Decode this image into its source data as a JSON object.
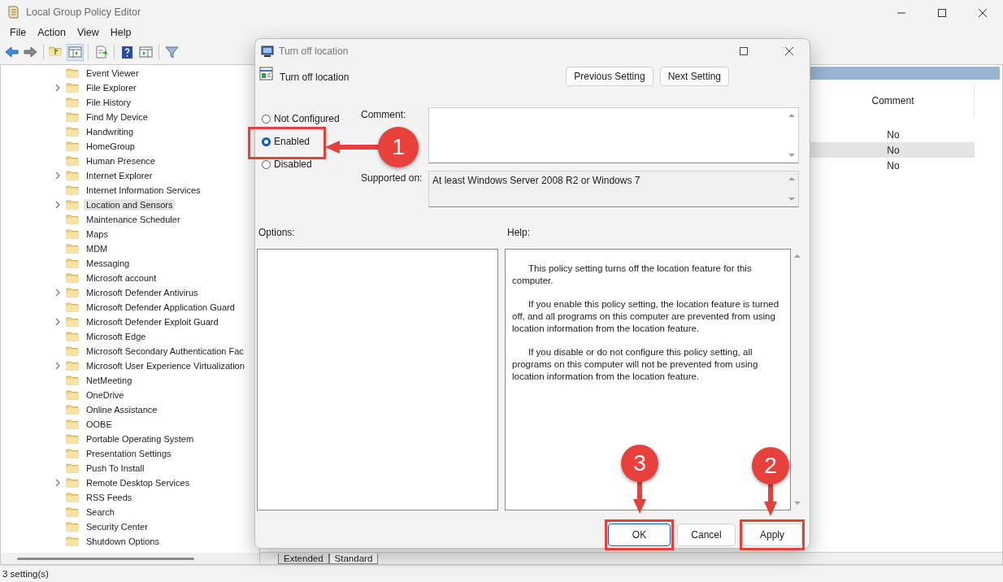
{
  "window": {
    "title": "Local Group Policy Editor"
  },
  "menu": [
    "File",
    "Action",
    "View",
    "Help"
  ],
  "tree": {
    "items": [
      {
        "label": "Event Viewer",
        "kind": "leaf",
        "selected": false
      },
      {
        "label": "File Explorer",
        "kind": "branch",
        "selected": false
      },
      {
        "label": "File History",
        "kind": "leaf",
        "selected": false
      },
      {
        "label": "Find My Device",
        "kind": "leaf",
        "selected": false
      },
      {
        "label": "Handwriting",
        "kind": "leaf",
        "selected": false
      },
      {
        "label": "HomeGroup",
        "kind": "leaf",
        "selected": false
      },
      {
        "label": "Human Presence",
        "kind": "leaf",
        "selected": false
      },
      {
        "label": "Internet Explorer",
        "kind": "branch",
        "selected": false
      },
      {
        "label": "Internet Information Services",
        "kind": "leaf",
        "selected": false
      },
      {
        "label": "Location and Sensors",
        "kind": "branch",
        "selected": true
      },
      {
        "label": "Maintenance Scheduler",
        "kind": "leaf",
        "selected": false
      },
      {
        "label": "Maps",
        "kind": "leaf",
        "selected": false
      },
      {
        "label": "MDM",
        "kind": "leaf",
        "selected": false
      },
      {
        "label": "Messaging",
        "kind": "leaf",
        "selected": false
      },
      {
        "label": "Microsoft account",
        "kind": "leaf",
        "selected": false
      },
      {
        "label": "Microsoft Defender Antivirus",
        "kind": "branch",
        "selected": false
      },
      {
        "label": "Microsoft Defender Application Guard",
        "kind": "leaf",
        "selected": false
      },
      {
        "label": "Microsoft Defender Exploit Guard",
        "kind": "branch",
        "selected": false
      },
      {
        "label": "Microsoft Edge",
        "kind": "leaf",
        "selected": false
      },
      {
        "label": "Microsoft Secondary Authentication Fac",
        "kind": "leaf",
        "selected": false
      },
      {
        "label": "Microsoft User Experience Virtualization",
        "kind": "branch",
        "selected": false
      },
      {
        "label": "NetMeeting",
        "kind": "leaf",
        "selected": false
      },
      {
        "label": "OneDrive",
        "kind": "leaf",
        "selected": false
      },
      {
        "label": "Online Assistance",
        "kind": "leaf",
        "selected": false
      },
      {
        "label": "OOBE",
        "kind": "leaf",
        "selected": false
      },
      {
        "label": "Portable Operating System",
        "kind": "leaf",
        "selected": false
      },
      {
        "label": "Presentation Settings",
        "kind": "leaf",
        "selected": false
      },
      {
        "label": "Push To Install",
        "kind": "leaf",
        "selected": false
      },
      {
        "label": "Remote Desktop Services",
        "kind": "branch",
        "selected": false
      },
      {
        "label": "RSS Feeds",
        "kind": "leaf",
        "selected": false
      },
      {
        "label": "Search",
        "kind": "leaf",
        "selected": false
      },
      {
        "label": "Security Center",
        "kind": "leaf",
        "selected": false
      },
      {
        "label": "Shutdown Options",
        "kind": "leaf",
        "selected": false
      }
    ]
  },
  "details": {
    "columns": [
      "Comment"
    ],
    "rows": [
      {
        "comment": "No",
        "selected": false
      },
      {
        "comment": "No",
        "selected": true
      },
      {
        "comment": "No",
        "selected": false
      }
    ],
    "tabs": [
      {
        "label": "Extended",
        "selected": false
      },
      {
        "label": "Standard",
        "selected": true
      }
    ]
  },
  "status_bar": "3 setting(s)",
  "dialog": {
    "title": "Turn off location",
    "heading": "Turn off location",
    "nav_buttons": [
      "Previous Setting",
      "Next Setting"
    ],
    "options": [
      {
        "label": "Not Configured",
        "selected": false
      },
      {
        "label": "Enabled",
        "selected": true
      },
      {
        "label": "Disabled",
        "selected": false
      }
    ],
    "comment_label": "Comment:",
    "supported_label": "Supported on:",
    "supported_value": "At least Windows Server 2008 R2 or Windows 7",
    "options_label": "Options:",
    "help_label": "Help:",
    "help": [
      "This policy setting turns off the location feature for this computer.",
      "If you enable this policy setting, the location feature is turned off, and all programs on this computer are prevented from using location information from the location feature.",
      "If you disable or do not configure this policy setting, all programs on this computer will not be prevented from using location information from the location feature."
    ],
    "buttons": [
      {
        "label": "OK",
        "kind": "default"
      },
      {
        "label": "Cancel",
        "kind": "normal"
      },
      {
        "label": "Apply",
        "kind": "normal"
      }
    ]
  },
  "annotations": [
    {
      "label": "1",
      "kind": "left"
    },
    {
      "label": "2",
      "kind": "down"
    },
    {
      "label": "3",
      "kind": "down"
    }
  ]
}
